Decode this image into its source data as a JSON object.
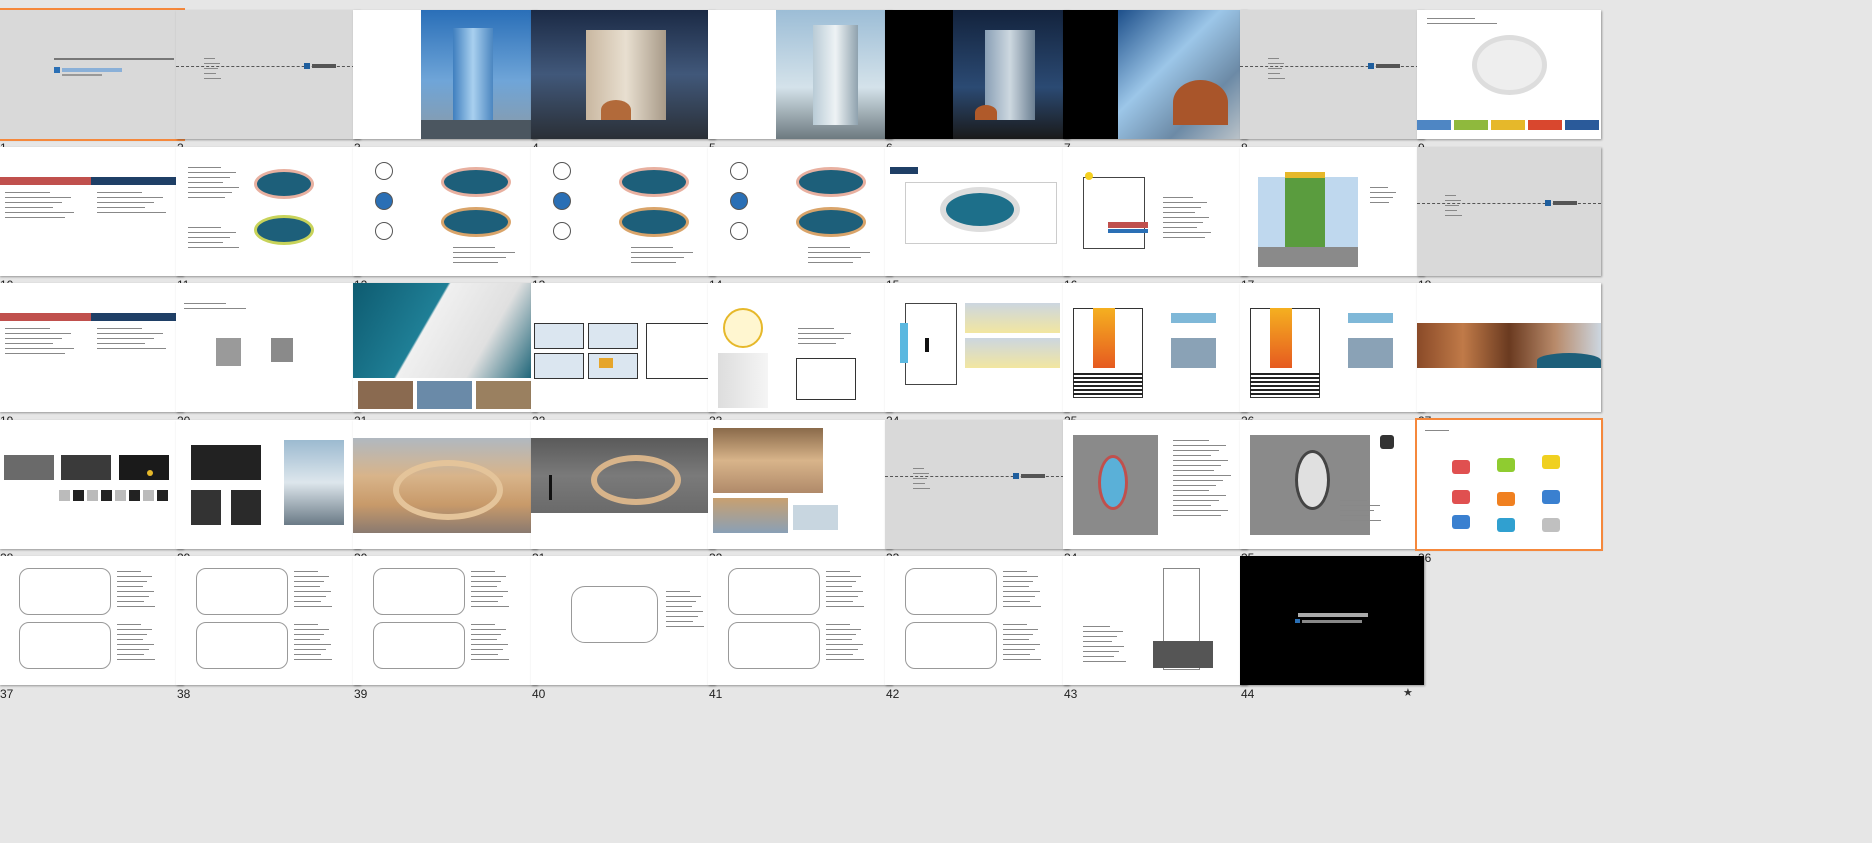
{
  "view": "slide-sorter",
  "selected_slides": [
    "1",
    "36"
  ],
  "slides": [
    {
      "number": "1",
      "style": "title-gray"
    },
    {
      "number": "2",
      "style": "section-gray"
    },
    {
      "number": "3",
      "style": "render-tower-blue"
    },
    {
      "number": "4",
      "style": "render-night-full"
    },
    {
      "number": "5",
      "style": "render-day-right"
    },
    {
      "number": "6",
      "style": "render-night-black"
    },
    {
      "number": "7",
      "style": "render-facade"
    },
    {
      "number": "8",
      "style": "section-gray"
    },
    {
      "number": "9",
      "style": "diagram-ring-colors"
    },
    {
      "number": "10",
      "style": "text-red-blue"
    },
    {
      "number": "11",
      "style": "diagram-rings"
    },
    {
      "number": "12",
      "style": "diagram-rings-icons"
    },
    {
      "number": "13",
      "style": "diagram-rings-icons"
    },
    {
      "number": "14",
      "style": "diagram-rings-icons"
    },
    {
      "number": "15",
      "style": "axon-site"
    },
    {
      "number": "16",
      "style": "section-diagram"
    },
    {
      "number": "17",
      "style": "program-stack"
    },
    {
      "number": "18",
      "style": "section-gray"
    },
    {
      "number": "19",
      "style": "text-red-blue"
    },
    {
      "number": "20",
      "style": "massing"
    },
    {
      "number": "21",
      "style": "render-atrium-teal"
    },
    {
      "number": "22",
      "style": "sketch-grid"
    },
    {
      "number": "23",
      "style": "diagram-sun"
    },
    {
      "number": "24",
      "style": "section-people"
    },
    {
      "number": "25",
      "style": "section-fire"
    },
    {
      "number": "26",
      "style": "section-fire"
    },
    {
      "number": "27",
      "style": "texture-rock"
    },
    {
      "number": "28",
      "style": "texture-bw"
    },
    {
      "number": "29",
      "style": "texture-tower"
    },
    {
      "number": "30",
      "style": "render-wood"
    },
    {
      "number": "31",
      "style": "render-wood-dark"
    },
    {
      "number": "32",
      "style": "render-wood-collage"
    },
    {
      "number": "33",
      "style": "section-gray"
    },
    {
      "number": "34",
      "style": "site-plan"
    },
    {
      "number": "35",
      "style": "site-plan-2"
    },
    {
      "number": "36",
      "style": "icons-color"
    },
    {
      "number": "37",
      "style": "floor-plan"
    },
    {
      "number": "38",
      "style": "floor-plan"
    },
    {
      "number": "39",
      "style": "floor-plan"
    },
    {
      "number": "40",
      "style": "floor-plan-single"
    },
    {
      "number": "41",
      "style": "floor-plan"
    },
    {
      "number": "42",
      "style": "floor-plan"
    },
    {
      "number": "43",
      "style": "section-tower"
    },
    {
      "number": "44",
      "style": "end-black"
    }
  ],
  "slide_44_transition_icon": "star-icon"
}
